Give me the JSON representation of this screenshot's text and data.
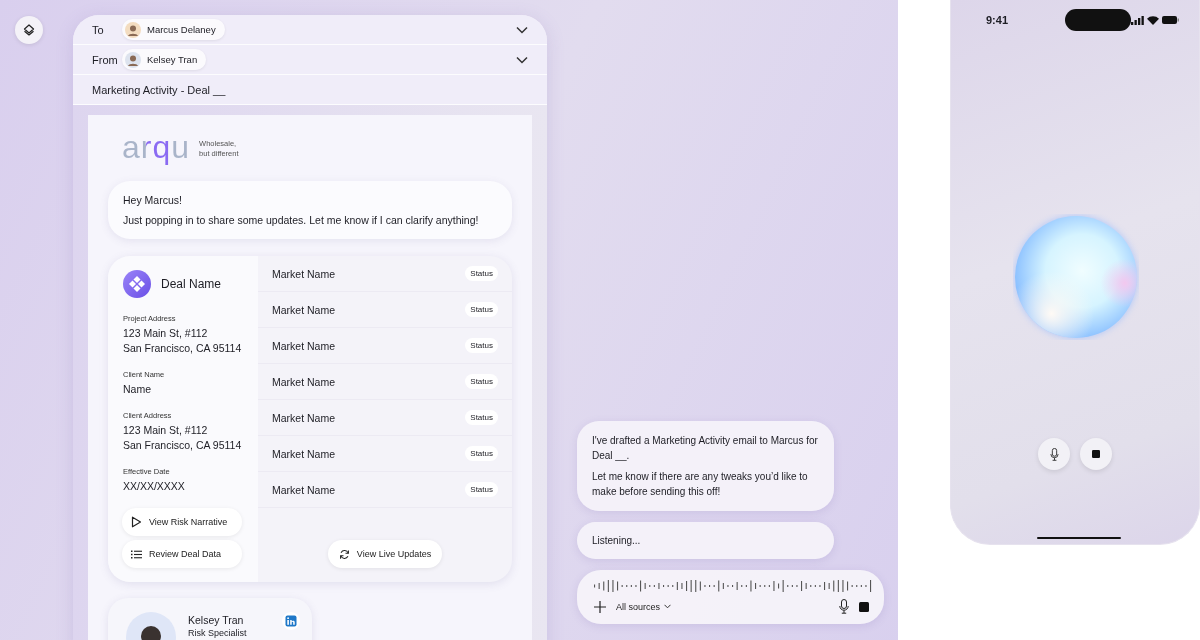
{
  "email": {
    "to": {
      "label": "To",
      "name": "Marcus Delaney"
    },
    "from": {
      "label": "From",
      "name": "Kelsey Tran"
    },
    "subject": "Marketing Activity - Deal __",
    "brand": {
      "logo": "arqu",
      "tagline_lines": [
        "Wholesale,",
        "but different"
      ]
    },
    "greeting": {
      "lines": [
        "Hey Marcus!",
        "Just popping in to share some updates. Let me know if I can clarify anything!"
      ]
    },
    "deal": {
      "title": "Deal Name",
      "fields": [
        {
          "label": "Project Address",
          "value_lines": [
            "123 Main St, #112",
            "San Francisco, CA 95114"
          ]
        },
        {
          "label": "Client Name",
          "value_lines": [
            "Name"
          ]
        },
        {
          "label": "Client Address",
          "value_lines": [
            "123 Main St, #112",
            "San Francisco, CA 95114"
          ]
        },
        {
          "label": "Effective Date",
          "value_lines": [
            "XX/XX/XXXX"
          ]
        }
      ],
      "actions": [
        {
          "kind": "play",
          "label": "View Risk Narrative"
        },
        {
          "kind": "list",
          "label": "Review Deal Data"
        }
      ],
      "markets": [
        {
          "name": "Market Name",
          "status": "Status"
        },
        {
          "name": "Market Name",
          "status": "Status"
        },
        {
          "name": "Market Name",
          "status": "Status"
        },
        {
          "name": "Market Name",
          "status": "Status"
        },
        {
          "name": "Market Name",
          "status": "Status"
        },
        {
          "name": "Market Name",
          "status": "Status"
        },
        {
          "name": "Market Name",
          "status": "Status"
        }
      ],
      "live_button": "View Live Updates"
    },
    "contact": {
      "name": "Kelsey Tran",
      "role": "Risk Specialist"
    }
  },
  "assistant": {
    "messages": [
      {
        "kind": "reply",
        "paragraphs": [
          "I've drafted a Marketing Activity email to Marcus for Deal __.",
          "Let me know if there are any tweaks you’d like to make before sending this off!"
        ]
      },
      {
        "kind": "status",
        "paragraphs": [
          "Listening..."
        ]
      }
    ],
    "composer": {
      "source": "All sources"
    }
  },
  "phone": {
    "time": "9:41"
  }
}
